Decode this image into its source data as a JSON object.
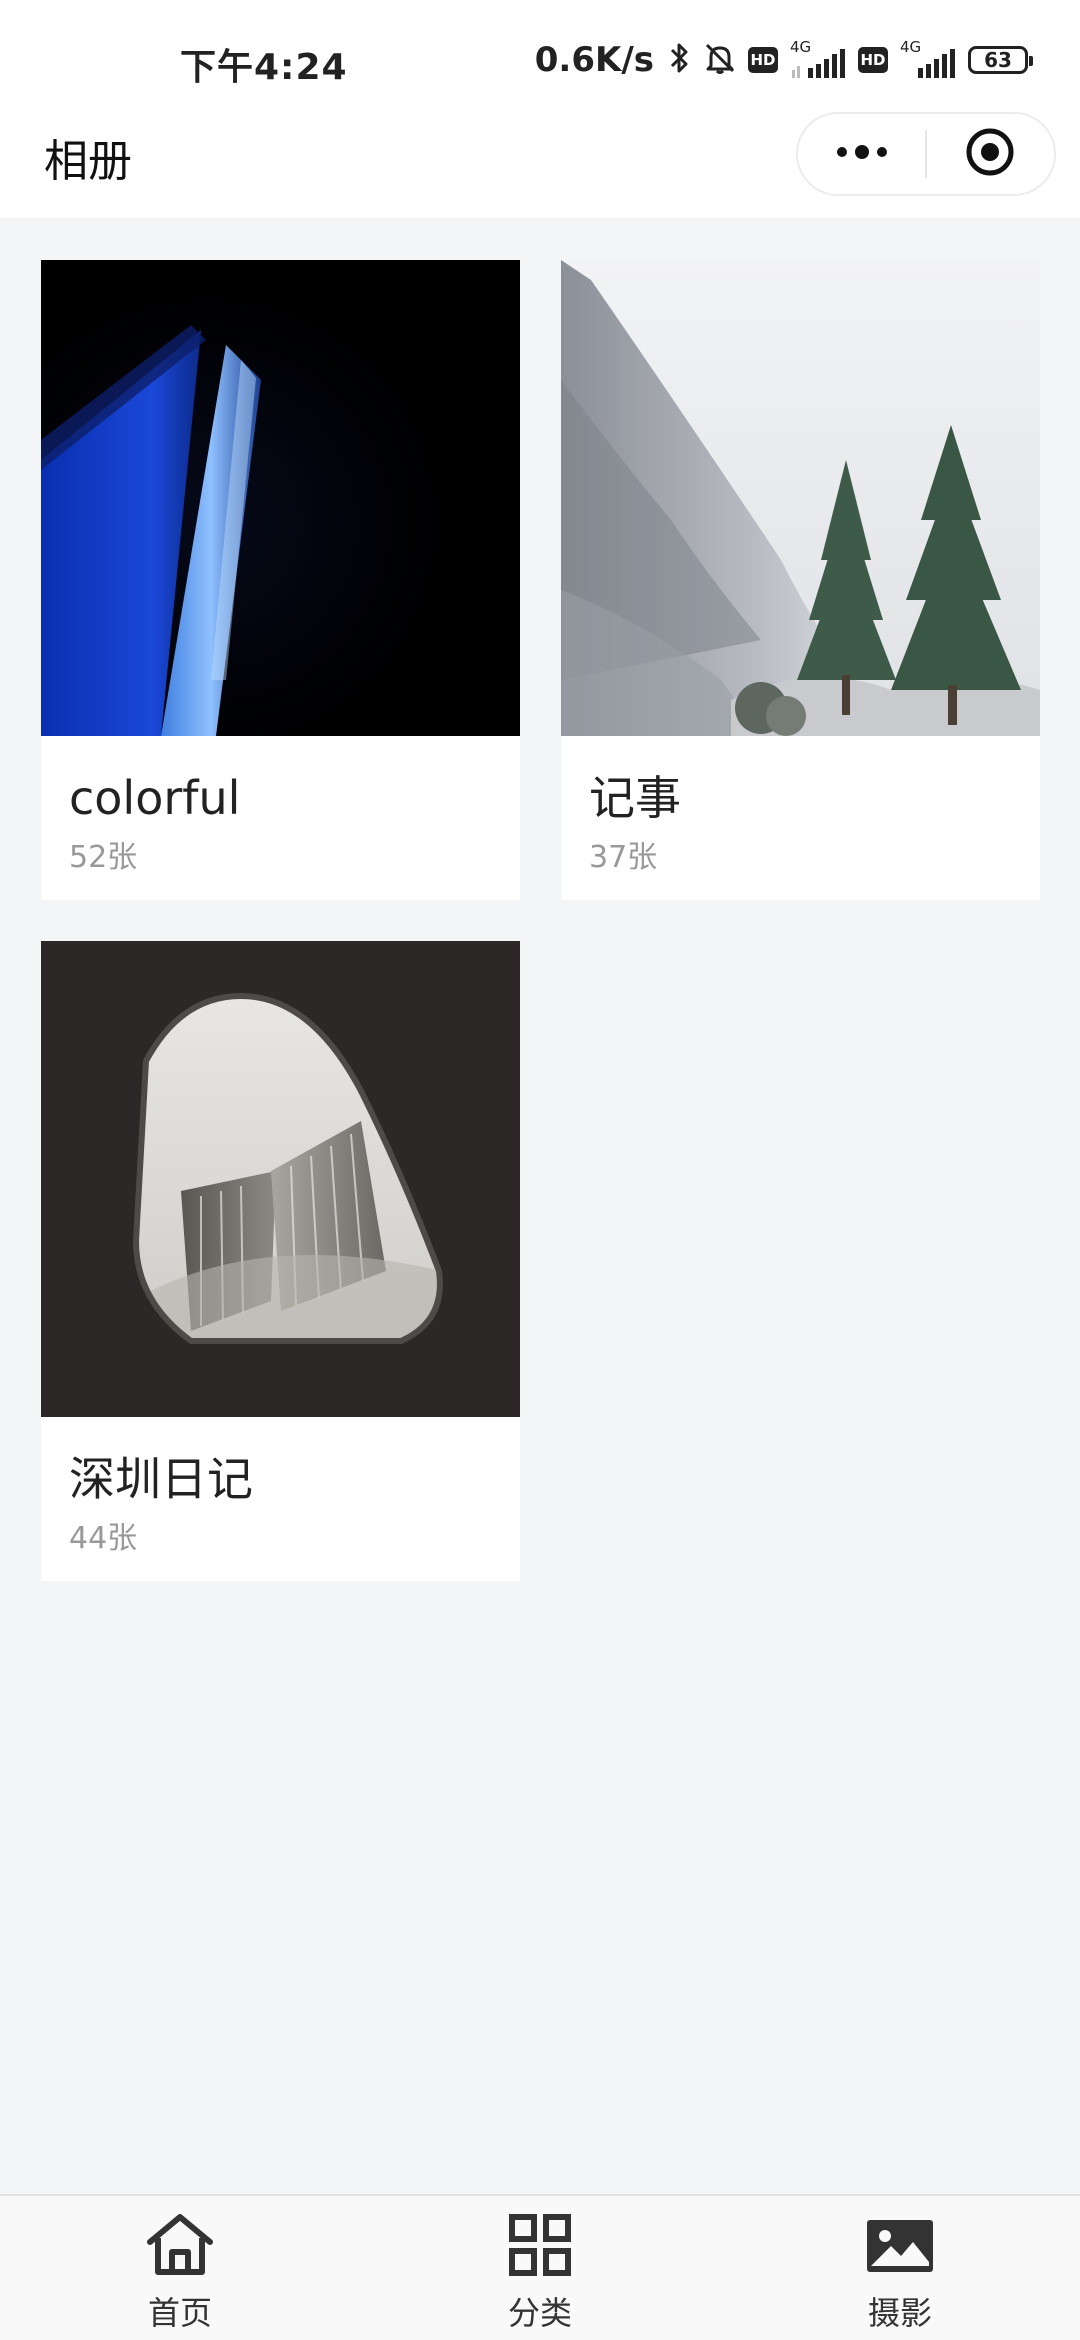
{
  "status_bar": {
    "time": "下午4:24",
    "network_speed": "0.6K/s",
    "hd_badge": "HD",
    "sim1_tech": "4G",
    "sim2_tech": "4G",
    "battery": "63"
  },
  "nav": {
    "title": "相册",
    "more_icon": "more-dots-icon",
    "close_icon": "target-circle-icon"
  },
  "albums": [
    {
      "name": "colorful",
      "count": "52张",
      "cover": "dark-blue-abstract"
    },
    {
      "name": "记事",
      "count": "37张",
      "cover": "misty-mountain-trees"
    },
    {
      "name": "深圳日记",
      "count": "44张",
      "cover": "building-through-arch"
    }
  ],
  "tabs": [
    {
      "label": "首页",
      "icon": "home-icon"
    },
    {
      "label": "分类",
      "icon": "grid-icon"
    },
    {
      "label": "摄影",
      "icon": "image-icon"
    }
  ],
  "colors": {
    "background": "#f4f5f7",
    "card": "#ffffff",
    "count_text": "#999999",
    "tab_icon": "#333333"
  }
}
